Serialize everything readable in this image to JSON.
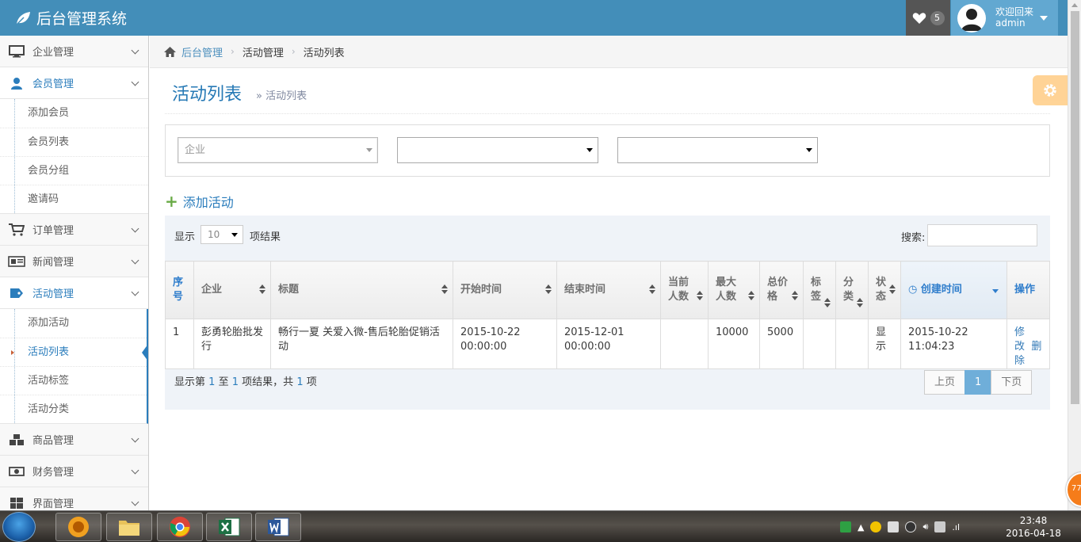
{
  "app": {
    "title": "后台管理系统"
  },
  "header": {
    "fav_count": "5",
    "welcome": "欢迎回来",
    "username": "admin"
  },
  "sidebar": {
    "items": [
      {
        "label": "企业管理",
        "icon": "desktop-icon"
      },
      {
        "label": "会员管理",
        "icon": "user-icon",
        "open": true,
        "children": [
          "添加会员",
          "会员列表",
          "会员分组",
          "邀请码"
        ]
      },
      {
        "label": "订单管理",
        "icon": "cart-icon"
      },
      {
        "label": "新闻管理",
        "icon": "newspaper-icon"
      },
      {
        "label": "活动管理",
        "icon": "tag-icon",
        "open": true,
        "children": [
          "添加活动",
          "活动列表",
          "活动标签",
          "活动分类"
        ],
        "active_child": "活动列表"
      },
      {
        "label": "商品管理",
        "icon": "cubes-icon"
      },
      {
        "label": "财务管理",
        "icon": "money-icon"
      },
      {
        "label": "界面管理",
        "icon": "windows-icon"
      }
    ]
  },
  "breadcrumb": {
    "home": "后台管理",
    "level1": "活动管理",
    "level2": "活动列表"
  },
  "page": {
    "title": "活动列表",
    "subtitle": "活动列表"
  },
  "filters": {
    "company_placeholder": "企业",
    "select2": "",
    "select3": ""
  },
  "actions": {
    "add_activity": "添加活动"
  },
  "table": {
    "length_label": "显示",
    "length_value": "10",
    "length_suffix": "项结果",
    "search_label": "搜索:",
    "columns": [
      "序号",
      "企业",
      "标题",
      "开始时间",
      "结束时间",
      "当前人数",
      "最大人数",
      "总价格",
      "标签",
      "分类",
      "状态",
      "创建时间",
      "操作"
    ],
    "rows": [
      {
        "no": "1",
        "company": "彭勇轮胎批发行",
        "title": "畅行一夏 关爱入微-售后轮胎促销活动",
        "start": "2015-10-22 00:00:00",
        "end": "2015-12-01 00:00:00",
        "current": "",
        "max": "10000",
        "price": "5000",
        "tag": "",
        "category": "",
        "status": "显示",
        "created": "2015-10-22 11:04:23",
        "edit": "修改",
        "delete": "删除"
      }
    ],
    "info_prefix": "显示第",
    "info_from": "1",
    "info_to_label": "至",
    "info_to": "1",
    "info_mid": "项结果，共",
    "info_total": "1",
    "info_suffix": "项"
  },
  "pagination": {
    "prev": "上页",
    "current": "1",
    "next": "下页"
  },
  "floating_badge": "77",
  "taskbar": {
    "time": "23:48",
    "date": "2016-04-18"
  },
  "colors": {
    "navbar": "#438eb9",
    "accent": "#2b7dbc",
    "user_bg": "#62a8d1",
    "settings": "#ffb752"
  }
}
